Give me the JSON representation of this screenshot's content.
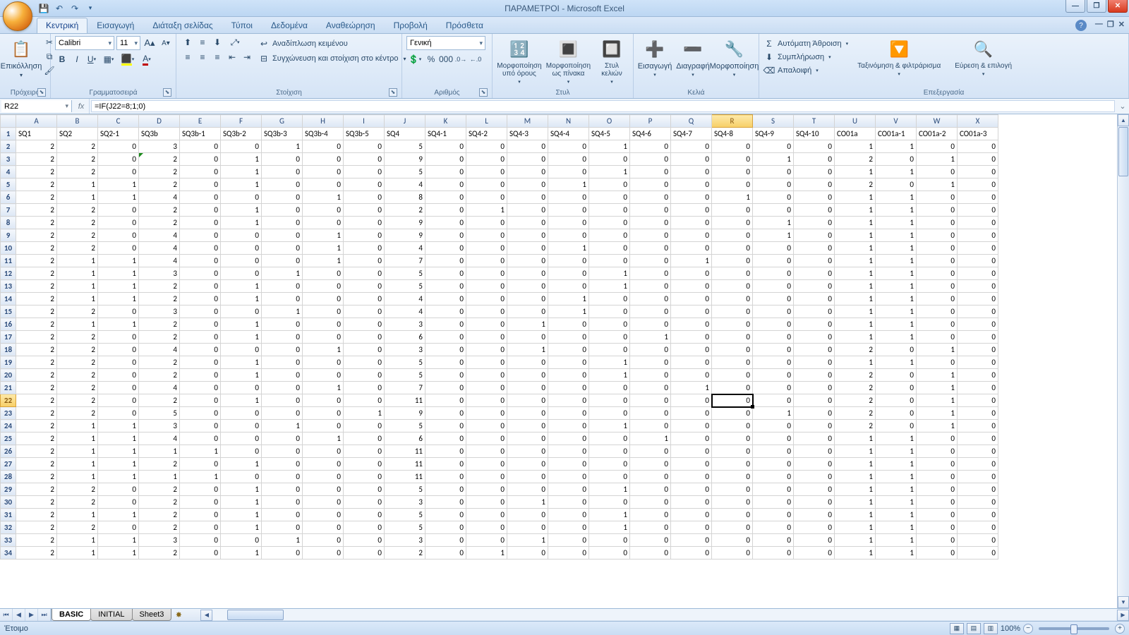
{
  "app": {
    "title": "ΠΑΡΑΜΕΤΡΟΙ - Microsoft Excel"
  },
  "qat": {
    "save": "💾",
    "undo": "↶",
    "redo": "↷",
    "more": "▾"
  },
  "tabs": [
    "Κεντρική",
    "Εισαγωγή",
    "Διάταξη σελίδας",
    "Τύποι",
    "Δεδομένα",
    "Αναθεώρηση",
    "Προβολή",
    "Πρόσθετα"
  ],
  "active_tab": 0,
  "ribbon": {
    "clipboard": {
      "label": "Πρόχειρο",
      "paste": "Επικόλληση"
    },
    "font": {
      "label": "Γραμματοσειρά",
      "name": "Calibri",
      "size": "11"
    },
    "align": {
      "label": "Στοίχιση",
      "wrap": "Αναδίπλωση κειμένου",
      "merge": "Συγχώνευση και στοίχιση στο κέντρο"
    },
    "number": {
      "label": "Αριθμός",
      "format": "Γενική"
    },
    "styles": {
      "label": "Στυλ",
      "cond": "Μορφοποίηση υπό όρους",
      "table": "Μορφοποίηση ως πίνακα",
      "cell": "Στυλ κελιών"
    },
    "cells": {
      "label": "Κελιά",
      "insert": "Εισαγωγή",
      "delete": "Διαγραφή",
      "format": "Μορφοποίηση"
    },
    "editing": {
      "label": "Επεξεργασία",
      "autosum": "Αυτόματη Άθροιση",
      "fill": "Συμπλήρωση",
      "clear": "Απαλοιφή",
      "sort": "Ταξινόμηση & φιλτράρισμα",
      "find": "Εύρεση & επιλογή"
    }
  },
  "formula_bar": {
    "name_box": "R22",
    "fx": "fx",
    "formula": "=IF(J22=8;1;0)"
  },
  "columns": [
    "A",
    "B",
    "C",
    "D",
    "E",
    "F",
    "G",
    "H",
    "I",
    "J",
    "K",
    "L",
    "M",
    "N",
    "O",
    "P",
    "Q",
    "R",
    "S",
    "T",
    "U",
    "V",
    "W",
    "X"
  ],
  "sel_col_index": 17,
  "sel_row_index": 21,
  "headers": [
    "SQ1",
    "SQ2",
    "SQ2-1",
    "SQ3b",
    "SQ3b-1",
    "SQ3b-2",
    "SQ3b-3",
    "SQ3b-4",
    "SQ3b-5",
    "SQ4",
    "SQ4-1",
    "SQ4-2",
    "SQ4-3",
    "SQ4-4",
    "SQ4-5",
    "SQ4-6",
    "SQ4-7",
    "SQ4-8",
    "SQ4-9",
    "SQ4-10",
    "CO01a",
    "CO01a-1",
    "CO01a-2",
    "CO01a-3"
  ],
  "last_col_overflow": "CO",
  "rows": [
    [
      2,
      2,
      0,
      3,
      0,
      0,
      1,
      0,
      0,
      5,
      0,
      0,
      0,
      0,
      1,
      0,
      0,
      0,
      0,
      0,
      1,
      1,
      0,
      0
    ],
    [
      2,
      2,
      0,
      2,
      0,
      1,
      0,
      0,
      0,
      9,
      0,
      0,
      0,
      0,
      0,
      0,
      0,
      0,
      1,
      0,
      2,
      0,
      1,
      0
    ],
    [
      2,
      2,
      0,
      2,
      0,
      1,
      0,
      0,
      0,
      5,
      0,
      0,
      0,
      0,
      1,
      0,
      0,
      0,
      0,
      0,
      1,
      1,
      0,
      0
    ],
    [
      2,
      1,
      1,
      2,
      0,
      1,
      0,
      0,
      0,
      4,
      0,
      0,
      0,
      1,
      0,
      0,
      0,
      0,
      0,
      0,
      2,
      0,
      1,
      0
    ],
    [
      2,
      1,
      1,
      4,
      0,
      0,
      0,
      1,
      0,
      8,
      0,
      0,
      0,
      0,
      0,
      0,
      0,
      1,
      0,
      0,
      1,
      1,
      0,
      0
    ],
    [
      2,
      2,
      0,
      2,
      0,
      1,
      0,
      0,
      0,
      2,
      0,
      1,
      0,
      0,
      0,
      0,
      0,
      0,
      0,
      0,
      1,
      1,
      0,
      0
    ],
    [
      2,
      2,
      0,
      2,
      0,
      1,
      0,
      0,
      0,
      9,
      0,
      0,
      0,
      0,
      0,
      0,
      0,
      0,
      1,
      0,
      1,
      1,
      0,
      0
    ],
    [
      2,
      2,
      0,
      4,
      0,
      0,
      0,
      1,
      0,
      9,
      0,
      0,
      0,
      0,
      0,
      0,
      0,
      0,
      1,
      0,
      1,
      1,
      0,
      0
    ],
    [
      2,
      2,
      0,
      4,
      0,
      0,
      0,
      1,
      0,
      4,
      0,
      0,
      0,
      1,
      0,
      0,
      0,
      0,
      0,
      0,
      1,
      1,
      0,
      0
    ],
    [
      2,
      1,
      1,
      4,
      0,
      0,
      0,
      1,
      0,
      7,
      0,
      0,
      0,
      0,
      0,
      0,
      1,
      0,
      0,
      0,
      1,
      1,
      0,
      0
    ],
    [
      2,
      1,
      1,
      3,
      0,
      0,
      1,
      0,
      0,
      5,
      0,
      0,
      0,
      0,
      1,
      0,
      0,
      0,
      0,
      0,
      1,
      1,
      0,
      0
    ],
    [
      2,
      1,
      1,
      2,
      0,
      1,
      0,
      0,
      0,
      5,
      0,
      0,
      0,
      0,
      1,
      0,
      0,
      0,
      0,
      0,
      1,
      1,
      0,
      0
    ],
    [
      2,
      1,
      1,
      2,
      0,
      1,
      0,
      0,
      0,
      4,
      0,
      0,
      0,
      1,
      0,
      0,
      0,
      0,
      0,
      0,
      1,
      1,
      0,
      0
    ],
    [
      2,
      2,
      0,
      3,
      0,
      0,
      1,
      0,
      0,
      4,
      0,
      0,
      0,
      1,
      0,
      0,
      0,
      0,
      0,
      0,
      1,
      1,
      0,
      0
    ],
    [
      2,
      1,
      1,
      2,
      0,
      1,
      0,
      0,
      0,
      3,
      0,
      0,
      1,
      0,
      0,
      0,
      0,
      0,
      0,
      0,
      1,
      1,
      0,
      0
    ],
    [
      2,
      2,
      0,
      2,
      0,
      1,
      0,
      0,
      0,
      6,
      0,
      0,
      0,
      0,
      0,
      1,
      0,
      0,
      0,
      0,
      1,
      1,
      0,
      0
    ],
    [
      2,
      2,
      0,
      4,
      0,
      0,
      0,
      1,
      0,
      3,
      0,
      0,
      1,
      0,
      0,
      0,
      0,
      0,
      0,
      0,
      2,
      0,
      1,
      0
    ],
    [
      2,
      2,
      0,
      2,
      0,
      1,
      0,
      0,
      0,
      5,
      0,
      0,
      0,
      0,
      1,
      0,
      0,
      0,
      0,
      0,
      1,
      1,
      0,
      0
    ],
    [
      2,
      2,
      0,
      2,
      0,
      1,
      0,
      0,
      0,
      5,
      0,
      0,
      0,
      0,
      1,
      0,
      0,
      0,
      0,
      0,
      2,
      0,
      1,
      0
    ],
    [
      2,
      2,
      0,
      4,
      0,
      0,
      0,
      1,
      0,
      7,
      0,
      0,
      0,
      0,
      0,
      0,
      1,
      0,
      0,
      0,
      2,
      0,
      1,
      0
    ],
    [
      2,
      2,
      0,
      2,
      0,
      1,
      0,
      0,
      0,
      11,
      0,
      0,
      0,
      0,
      0,
      0,
      0,
      0,
      0,
      0,
      2,
      0,
      1,
      0
    ],
    [
      2,
      2,
      0,
      5,
      0,
      0,
      0,
      0,
      1,
      9,
      0,
      0,
      0,
      0,
      0,
      0,
      0,
      0,
      1,
      0,
      2,
      0,
      1,
      0
    ],
    [
      2,
      1,
      1,
      3,
      0,
      0,
      1,
      0,
      0,
      5,
      0,
      0,
      0,
      0,
      1,
      0,
      0,
      0,
      0,
      0,
      2,
      0,
      1,
      0
    ],
    [
      2,
      1,
      1,
      4,
      0,
      0,
      0,
      1,
      0,
      6,
      0,
      0,
      0,
      0,
      0,
      1,
      0,
      0,
      0,
      0,
      1,
      1,
      0,
      0
    ],
    [
      2,
      1,
      1,
      1,
      1,
      0,
      0,
      0,
      0,
      11,
      0,
      0,
      0,
      0,
      0,
      0,
      0,
      0,
      0,
      0,
      1,
      1,
      0,
      0
    ],
    [
      2,
      1,
      1,
      2,
      0,
      1,
      0,
      0,
      0,
      11,
      0,
      0,
      0,
      0,
      0,
      0,
      0,
      0,
      0,
      0,
      1,
      1,
      0,
      0
    ],
    [
      2,
      1,
      1,
      1,
      1,
      0,
      0,
      0,
      0,
      11,
      0,
      0,
      0,
      0,
      0,
      0,
      0,
      0,
      0,
      0,
      1,
      1,
      0,
      0
    ],
    [
      2,
      2,
      0,
      2,
      0,
      1,
      0,
      0,
      0,
      5,
      0,
      0,
      0,
      0,
      1,
      0,
      0,
      0,
      0,
      0,
      1,
      1,
      0,
      0
    ],
    [
      2,
      2,
      0,
      2,
      0,
      1,
      0,
      0,
      0,
      3,
      0,
      0,
      1,
      0,
      0,
      0,
      0,
      0,
      0,
      0,
      1,
      1,
      0,
      0
    ],
    [
      2,
      1,
      1,
      2,
      0,
      1,
      0,
      0,
      0,
      5,
      0,
      0,
      0,
      0,
      1,
      0,
      0,
      0,
      0,
      0,
      1,
      1,
      0,
      0
    ],
    [
      2,
      2,
      0,
      2,
      0,
      1,
      0,
      0,
      0,
      5,
      0,
      0,
      0,
      0,
      1,
      0,
      0,
      0,
      0,
      0,
      1,
      1,
      0,
      0
    ],
    [
      2,
      1,
      1,
      3,
      0,
      0,
      1,
      0,
      0,
      3,
      0,
      0,
      1,
      0,
      0,
      0,
      0,
      0,
      0,
      0,
      1,
      1,
      0,
      0
    ],
    [
      2,
      1,
      1,
      2,
      0,
      1,
      0,
      0,
      0,
      2,
      0,
      1,
      0,
      0,
      0,
      0,
      0,
      0,
      0,
      0,
      1,
      1,
      0,
      0
    ]
  ],
  "err_cell": {
    "row": 1,
    "col": 3
  },
  "sheet_tabs": [
    "BASIC",
    "INITIAL",
    "Sheet3"
  ],
  "active_sheet": 0,
  "status": {
    "ready": "Έτοιμο",
    "zoom": "100%"
  }
}
